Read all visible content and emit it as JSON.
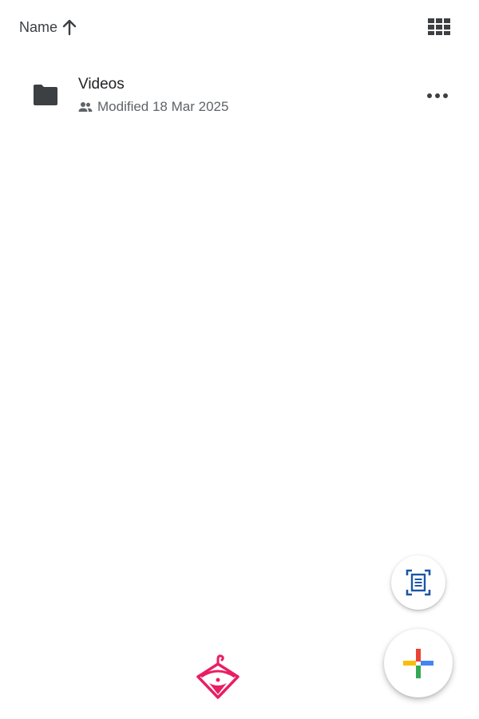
{
  "sort": {
    "label": "Name",
    "icon": "arrow-up-icon"
  },
  "view_toggle": {
    "icon": "grid-view-icon"
  },
  "items": [
    {
      "name": "Videos",
      "modified": "Modified 18 Mar 2025",
      "type_icon": "folder-icon",
      "shared_icon": "shared-people-icon"
    }
  ],
  "fabs": {
    "scan_icon": "document-scan-icon",
    "new_icon": "plus-icon"
  },
  "colors": {
    "folder": "#3c4043",
    "scan_accent": "#1a56a7",
    "plus_red": "#ea4335",
    "plus_blue": "#4285f4",
    "plus_yellow": "#fbbc04",
    "plus_green": "#34a853",
    "watermark": "#e91e63"
  }
}
